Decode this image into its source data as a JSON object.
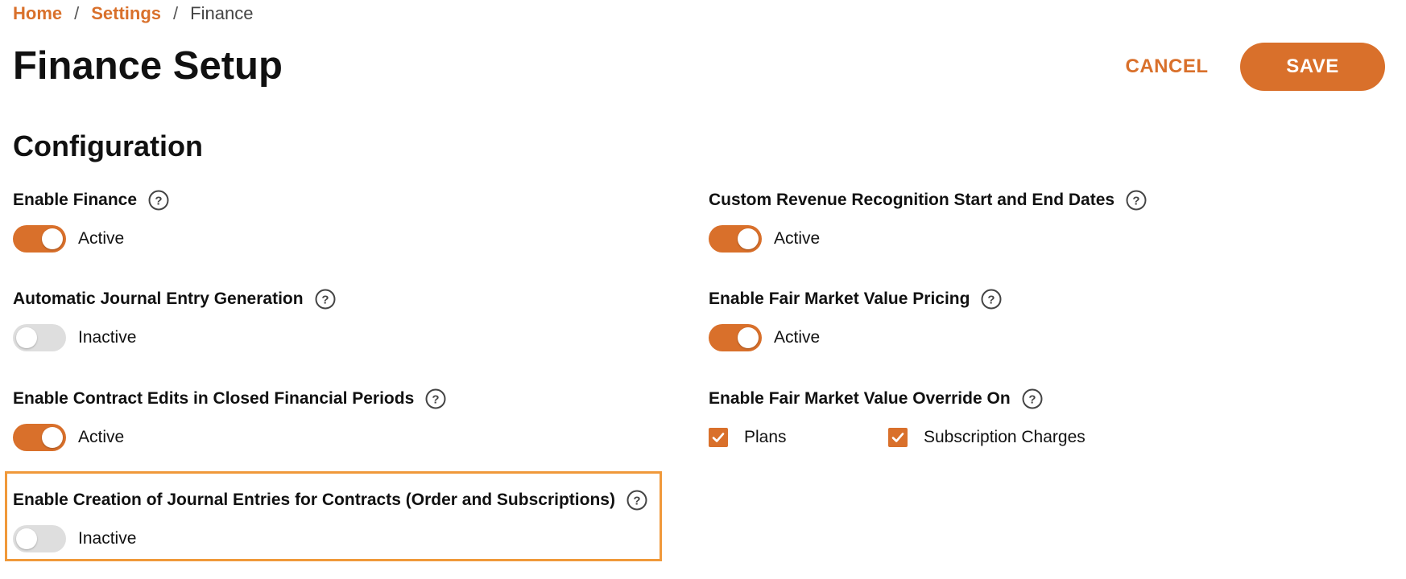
{
  "breadcrumb": {
    "home": "Home",
    "settings": "Settings",
    "current": "Finance",
    "separator": "/"
  },
  "page_title": "Finance Setup",
  "actions": {
    "cancel_label": "CANCEL",
    "save_label": "SAVE"
  },
  "section_title": "Configuration",
  "colors": {
    "accent": "#d9702b",
    "highlight": "#f0993a",
    "toggle_off": "#dedede"
  },
  "settings": {
    "enable_finance": {
      "label": "Enable Finance",
      "status": "Active",
      "on": true
    },
    "auto_journal": {
      "label": "Automatic Journal Entry Generation",
      "status": "Inactive",
      "on": false
    },
    "contract_edits": {
      "label": "Enable Contract Edits in Closed Financial Periods",
      "status": "Active",
      "on": true
    },
    "journal_contracts": {
      "label": "Enable Creation of Journal Entries for Contracts (Order and Subscriptions)",
      "status": "Inactive",
      "on": false
    },
    "custom_rev_rec": {
      "label": "Custom Revenue Recognition Start and End Dates",
      "status": "Active",
      "on": true
    },
    "fmv_pricing": {
      "label": "Enable Fair Market Value Pricing",
      "status": "Active",
      "on": true
    },
    "fmv_override": {
      "label": "Enable Fair Market Value Override On",
      "options": [
        {
          "label": "Plans",
          "checked": true
        },
        {
          "label": "Subscription Charges",
          "checked": true
        }
      ]
    }
  },
  "icons": {
    "help": "help-circle-icon",
    "check": "checkmark-icon"
  }
}
